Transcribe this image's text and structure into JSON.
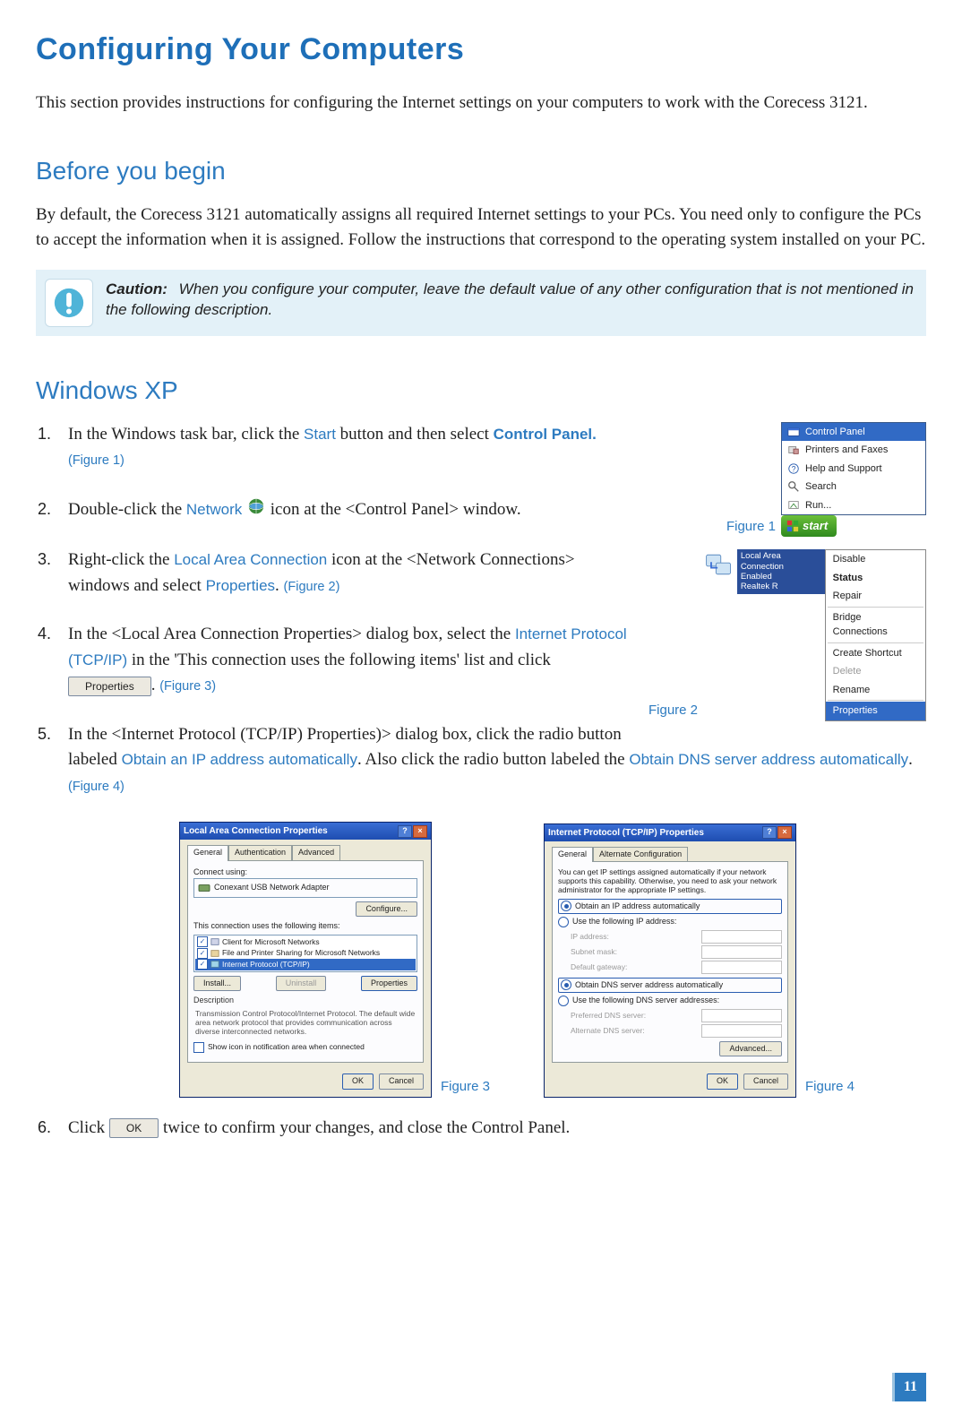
{
  "page_title": "Configuring Your Computers",
  "intro": "This section provides instructions for configuring the Internet settings on your computers to work with the Corecess 3121.",
  "h2_before": "Before you begin",
  "before_text": "By default, the Corecess 3121 automatically assigns all required Internet settings to your PCs. You need only to configure the PCs to accept the information when it is assigned. Follow the instructions that correspond to the operating system installed on your PC.",
  "caution_label": "Caution:",
  "caution_text": "When you configure your computer, leave the default value of any other configuration that is not mentioned in the following description.",
  "h2_xp": "Windows XP",
  "step1": {
    "a": "In the Windows task bar, click the ",
    "start": "Start",
    "b": " button and then select ",
    "cp": "Control Panel.",
    "fig": "(Figure 1)"
  },
  "step2": {
    "a": "Double-click the ",
    "net": "Network",
    "b": " icon at the <Control Panel> window."
  },
  "step3": {
    "a": "Right-click the ",
    "lac": "Local Area Connection",
    "b": " icon at the <Network Connections> windows and select ",
    "prop": "Properties",
    "c": ". ",
    "fig": "(Figure 2)"
  },
  "step4": {
    "a": "In the <Local Area Connection Properties> dialog box, select the ",
    "ip": "Internet Protocol (TCP/IP)",
    "b": " in the 'This connection uses the following items' list and click ",
    "btn": "Properties",
    "c": ". ",
    "fig": "(Figure 3)"
  },
  "step5": {
    "a": "In the <Internet Protocol (TCP/IP) Properties)> dialog box, click the radio button labeled ",
    "r1": "Obtain an IP address automatically",
    "b": ". Also click the radio button labeled the ",
    "r2": "Obtain DNS server address automatically",
    "c": ". ",
    "fig": "(Figure 4)"
  },
  "step6": {
    "a": "Click ",
    "btn": "OK",
    "b": " twice to confirm your changes, and close the Control Panel."
  },
  "fig1": {
    "label": "Figure 1",
    "items": [
      "Control Panel",
      "Printers and Faxes",
      "Help and Support",
      "Search",
      "Run..."
    ],
    "start": "start"
  },
  "fig2": {
    "label": "Figure 2",
    "tip": [
      "Local Area Connection",
      "Enabled",
      "Realtek R"
    ],
    "menu": [
      "Disable",
      "Status",
      "Repair",
      "Bridge Connections",
      "Create Shortcut",
      "Delete",
      "Rename",
      "Properties"
    ]
  },
  "fig3": {
    "label": "Figure 3",
    "title": "Local Area Connection Properties",
    "tabs": [
      "General",
      "Authentication",
      "Advanced"
    ],
    "conn_label": "Connect using:",
    "adapter": "Conexant USB Network Adapter",
    "configure": "Configure...",
    "uses": "This connection uses the following items:",
    "items": [
      "Client for Microsoft Networks",
      "File and Printer Sharing for Microsoft Networks",
      "Internet Protocol (TCP/IP)"
    ],
    "btns": [
      "Install...",
      "Uninstall",
      "Properties"
    ],
    "desc_t": "Description",
    "desc": "Transmission Control Protocol/Internet Protocol. The default wide area network protocol that provides communication across diverse interconnected networks.",
    "show_icon": "Show icon in notification area when connected",
    "ok": "OK",
    "cancel": "Cancel"
  },
  "fig4": {
    "label": "Figure 4",
    "title": "Internet Protocol (TCP/IP) Properties",
    "tabs": [
      "General",
      "Alternate Configuration"
    ],
    "instr": "You can get IP settings assigned automatically if your network supports this capability. Otherwise, you need to ask your network administrator for the appropriate IP settings.",
    "r_auto_ip": "Obtain an IP address automatically",
    "r_man_ip": "Use the following IP address:",
    "f_ip": "IP address:",
    "f_sub": "Subnet mask:",
    "f_gw": "Default gateway:",
    "r_auto_dns": "Obtain DNS server address automatically",
    "r_man_dns": "Use the following DNS server addresses:",
    "f_pdns": "Preferred DNS server:",
    "f_adns": "Alternate DNS server:",
    "adv": "Advanced...",
    "ok": "OK",
    "cancel": "Cancel"
  },
  "page_number": "11"
}
